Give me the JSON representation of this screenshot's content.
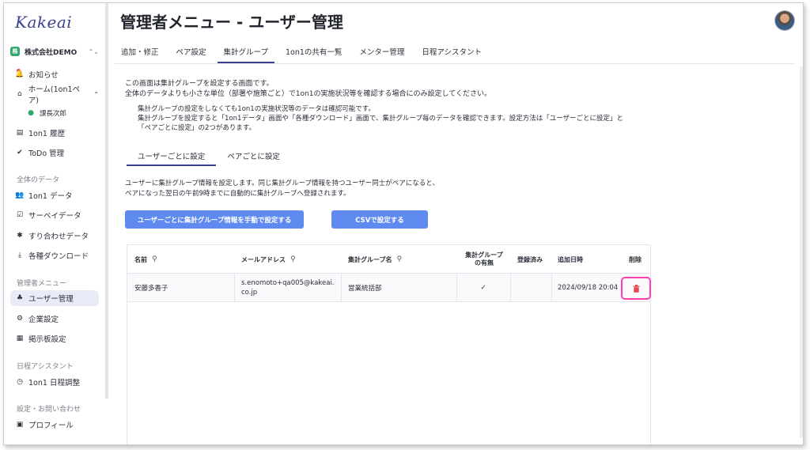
{
  "app": {
    "logo": "Kakeai"
  },
  "org": {
    "badge": "株",
    "name": "株式会社DEMO",
    "toggle": "⌃⌄"
  },
  "sidebar": {
    "items": [
      {
        "label": "お知らせ",
        "icon": "🔔"
      },
      {
        "label": "ホーム(1on1ペア)",
        "icon": "⌂",
        "chevron": "⌃"
      },
      {
        "label": "課長次郎",
        "icon": "●"
      },
      {
        "label": "1on1 履歴",
        "icon": "▤"
      },
      {
        "label": "ToDo 管理",
        "icon": "✔"
      }
    ],
    "section_data": "全体のデータ",
    "data_items": [
      {
        "label": "1on1 データ",
        "icon": "👥"
      },
      {
        "label": "サーベイデータ",
        "icon": "☑"
      },
      {
        "label": "すり合わせデータ",
        "icon": "✱"
      },
      {
        "label": "各種ダウンロード",
        "icon": "⤓"
      }
    ],
    "section_admin": "管理者メニュー",
    "admin_items": [
      {
        "label": "ユーザー管理",
        "icon": "♣"
      },
      {
        "label": "企業設定",
        "icon": "⚙"
      },
      {
        "label": "掲示板設定",
        "icon": "▦"
      }
    ],
    "section_schedule": "日程アシスタント",
    "schedule_items": [
      {
        "label": "1on1 日程調整",
        "icon": "◷"
      }
    ],
    "section_settings": "設定・お問い合わせ",
    "settings_items": [
      {
        "label": "プロフィール",
        "icon": "▣"
      }
    ]
  },
  "page": {
    "title": "管理者メニュー - ユーザー管理"
  },
  "tabs": [
    "追加・修正",
    "ペア設定",
    "集計グループ",
    "1on1の共有一覧",
    "メンター管理",
    "日程アシスタント"
  ],
  "intro": {
    "line1": "この画面は集計グループを設定する画面です。",
    "line2": "全体のデータよりも小さな単位（部署や施策ごと）で1on1の実施状況等を確認する場合にのみ設定してください。",
    "note1": "集計グループの設定をしなくても1on1の実施状況等のデータは確認可能です。",
    "note2": "集計グループを設定すると「1on1データ」画面や「各種ダウンロード」画面で、集計グループ毎のデータを確認できます。設定方法は「ユーザーごとに設定」と",
    "note3": "「ペアごとに設定」の2つがあります。"
  },
  "subtabs": [
    "ユーザーごとに設定",
    "ペアごとに設定"
  ],
  "user_setting": {
    "line1": "ユーザーに集計グループ情報を設定します。同じ集計グループ情報を持つユーザー同士がペアになると、",
    "line2": "ペアになった翌日の午前9時までに自動的に集計グループへ登録されます。",
    "manual_button": "ユーザーごとに集計グループ情報を手動で設定する",
    "csv_button": "CSVで設定する"
  },
  "table": {
    "headers": {
      "name": "名前",
      "email": "メールアドレス",
      "group": "集計グループ名",
      "has_group_1": "集計グループ",
      "has_group_2": "の有無",
      "registered": "登録済み",
      "added": "追加日時",
      "delete": "削除"
    },
    "rows": [
      {
        "name": "安藤多香子",
        "email_1": "s.enomoto+qa005@kakeai.",
        "email_2": "co.jp",
        "group": "営業統括部",
        "has_group": "✓",
        "registered": "",
        "added": "2024/09/18 20:04"
      }
    ]
  },
  "colors": {
    "accent": "#3b3f8f",
    "button": "#5f8af0",
    "highlight": "#ff3fb1",
    "danger": "#e5484d"
  }
}
